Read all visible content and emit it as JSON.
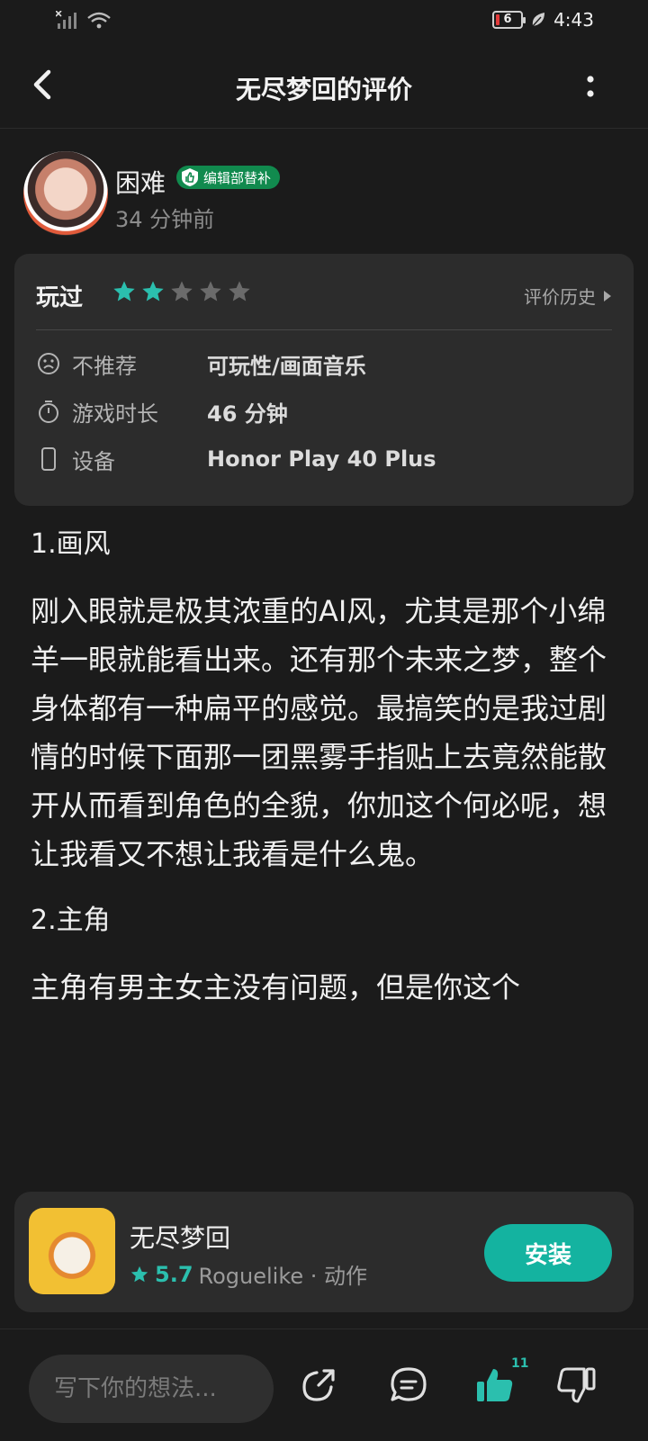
{
  "status_bar": {
    "battery": "6",
    "time": "4:43"
  },
  "header": {
    "title": "无尽梦回的评价"
  },
  "user": {
    "name": "困难",
    "badge": "编辑部替补",
    "time_ago": "34 分钟前"
  },
  "review": {
    "played_label": "玩过",
    "rating": 2,
    "max_rating": 5,
    "history_label": "评价历史",
    "rows": [
      {
        "icon": "frown-face-icon",
        "label": "不推荐",
        "value": "可玩性/画面音乐"
      },
      {
        "icon": "stopwatch-icon",
        "label": "游戏时长",
        "value": "46 分钟"
      },
      {
        "icon": "phone-device-icon",
        "label": "设备",
        "value": "Honor Play 40 Plus"
      }
    ]
  },
  "body": {
    "heading1": "1.画风",
    "para1": "刚入眼就是极其浓重的AI风，尤其是那个小绵羊一眼就能看出来。还有那个未来之梦，整个身体都有一种扁平的感觉。最搞笑的是我过剧情的时候下面那一团黑雾手指贴上去竟然能散开从而看到角色的全貌，你加这个何必呢，想让我看又不想让我看是什么鬼。",
    "heading2": "2.主角",
    "para2": "主角有男主女主没有问题，但是你这个"
  },
  "app": {
    "name": "无尽梦回",
    "rating": "5.7",
    "tags": "Roguelike · 动作",
    "install_label": "安装"
  },
  "bottom_bar": {
    "comment_placeholder": "写下你的想法...",
    "like_count": "11"
  },
  "colors": {
    "accent": "#14b3a0",
    "star_on": "#2bbfae",
    "star_off": "#6b6b6b",
    "badge": "#118a4e"
  }
}
